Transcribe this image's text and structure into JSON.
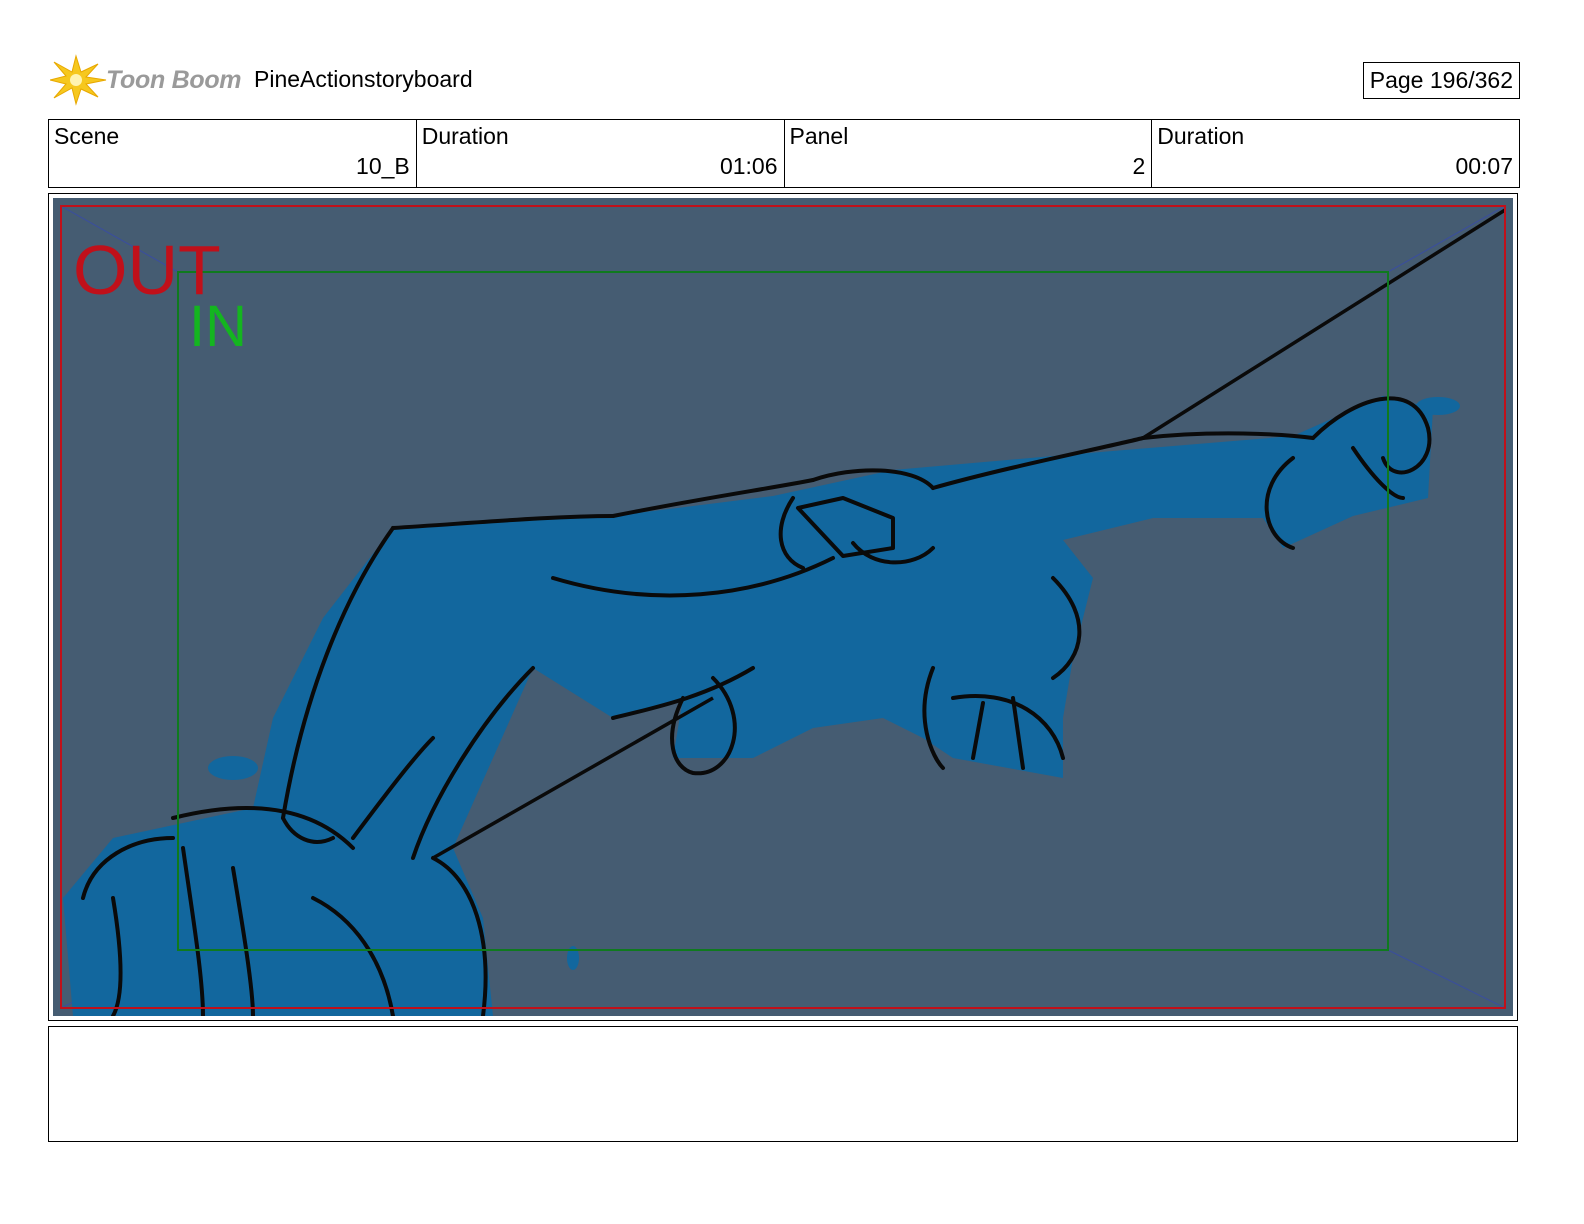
{
  "header": {
    "logo_text": "Toon Boom",
    "project_title": "PineActionstoryboard",
    "page_label": "Page 196/362"
  },
  "info": {
    "scene_label": "Scene",
    "scene_value": "10_B",
    "scene_duration_label": "Duration",
    "scene_duration_value": "01:06",
    "panel_label": "Panel",
    "panel_value": "2",
    "panel_duration_label": "Duration",
    "panel_duration_value": "00:07"
  },
  "panel": {
    "out_label": "OUT",
    "in_label": "IN",
    "background_color": "#455c72",
    "character_fill": "#12679e",
    "out_frame_color": "#c0101a",
    "in_frame_color": "#0f7a1e"
  },
  "caption": {
    "text": ""
  }
}
